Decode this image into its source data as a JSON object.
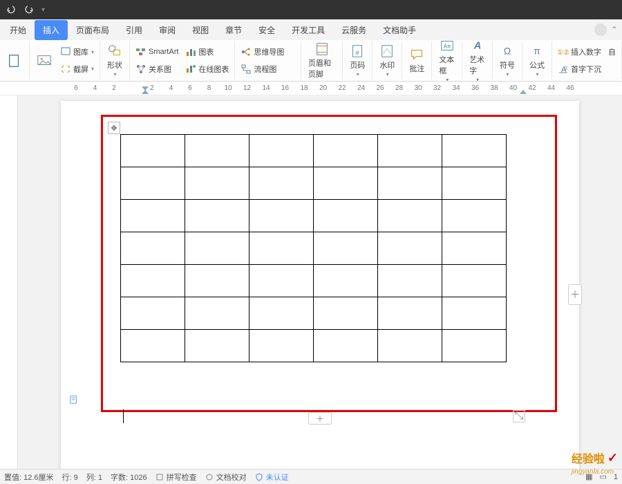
{
  "titlebar": {
    "undo_tip": "↶",
    "redo_tip": "↷"
  },
  "menu": {
    "tabs": [
      "开始",
      "插入",
      "页面布局",
      "引用",
      "审阅",
      "视图",
      "章节",
      "安全",
      "开发工具",
      "云服务",
      "文档助手"
    ],
    "active_index": 1
  },
  "ribbon": {
    "gallery": "图库",
    "screenshot": "截屏",
    "shapes": "形状",
    "smartart": "SmartArt",
    "relation": "关系图",
    "chart": "图表",
    "online_chart": "在线图表",
    "mind_map": "思维导图",
    "flow_chart": "流程图",
    "header_footer": "页眉和页脚",
    "page_number": "页码",
    "watermark": "水印",
    "comment": "批注",
    "textbox": "文本框",
    "wordart": "艺术字",
    "symbol": "符号",
    "equation": "公式",
    "insert_number": "插入数字",
    "drop_cap": "首字下沉",
    "auto": "自"
  },
  "ruler": {
    "labels": [
      "6",
      "4",
      "2",
      "",
      "2",
      "4",
      "6",
      "8",
      "10",
      "12",
      "14",
      "16",
      "18",
      "20",
      "22",
      "24",
      "26",
      "28",
      "30",
      "32",
      "34",
      "36",
      "38",
      "40",
      "42",
      "44",
      "46"
    ]
  },
  "status": {
    "position": "置值: 12.6厘米",
    "line": "行: 9",
    "column": "列: 1",
    "words": "字数: 1026",
    "spell_check": "拼写检查",
    "doc_proof": "文档校对",
    "not_verified": "未认证",
    "zoom": "1"
  },
  "watermark": {
    "brand": "经验啦",
    "url": "jingyanla.com"
  },
  "table": {
    "rows": 7,
    "cols": 6
  }
}
